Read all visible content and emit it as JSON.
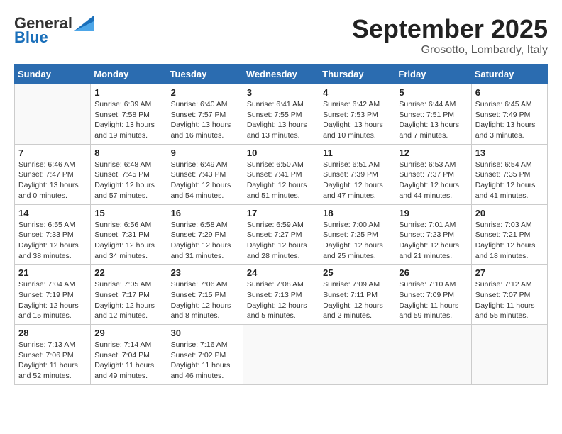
{
  "logo": {
    "general": "General",
    "blue": "Blue"
  },
  "title": "September 2025",
  "subtitle": "Grosotto, Lombardy, Italy",
  "days_of_week": [
    "Sunday",
    "Monday",
    "Tuesday",
    "Wednesday",
    "Thursday",
    "Friday",
    "Saturday"
  ],
  "weeks": [
    [
      {
        "day": "",
        "info": ""
      },
      {
        "day": "1",
        "info": "Sunrise: 6:39 AM\nSunset: 7:58 PM\nDaylight: 13 hours\nand 19 minutes."
      },
      {
        "day": "2",
        "info": "Sunrise: 6:40 AM\nSunset: 7:57 PM\nDaylight: 13 hours\nand 16 minutes."
      },
      {
        "day": "3",
        "info": "Sunrise: 6:41 AM\nSunset: 7:55 PM\nDaylight: 13 hours\nand 13 minutes."
      },
      {
        "day": "4",
        "info": "Sunrise: 6:42 AM\nSunset: 7:53 PM\nDaylight: 13 hours\nand 10 minutes."
      },
      {
        "day": "5",
        "info": "Sunrise: 6:44 AM\nSunset: 7:51 PM\nDaylight: 13 hours\nand 7 minutes."
      },
      {
        "day": "6",
        "info": "Sunrise: 6:45 AM\nSunset: 7:49 PM\nDaylight: 13 hours\nand 3 minutes."
      }
    ],
    [
      {
        "day": "7",
        "info": "Sunrise: 6:46 AM\nSunset: 7:47 PM\nDaylight: 13 hours\nand 0 minutes."
      },
      {
        "day": "8",
        "info": "Sunrise: 6:48 AM\nSunset: 7:45 PM\nDaylight: 12 hours\nand 57 minutes."
      },
      {
        "day": "9",
        "info": "Sunrise: 6:49 AM\nSunset: 7:43 PM\nDaylight: 12 hours\nand 54 minutes."
      },
      {
        "day": "10",
        "info": "Sunrise: 6:50 AM\nSunset: 7:41 PM\nDaylight: 12 hours\nand 51 minutes."
      },
      {
        "day": "11",
        "info": "Sunrise: 6:51 AM\nSunset: 7:39 PM\nDaylight: 12 hours\nand 47 minutes."
      },
      {
        "day": "12",
        "info": "Sunrise: 6:53 AM\nSunset: 7:37 PM\nDaylight: 12 hours\nand 44 minutes."
      },
      {
        "day": "13",
        "info": "Sunrise: 6:54 AM\nSunset: 7:35 PM\nDaylight: 12 hours\nand 41 minutes."
      }
    ],
    [
      {
        "day": "14",
        "info": "Sunrise: 6:55 AM\nSunset: 7:33 PM\nDaylight: 12 hours\nand 38 minutes."
      },
      {
        "day": "15",
        "info": "Sunrise: 6:56 AM\nSunset: 7:31 PM\nDaylight: 12 hours\nand 34 minutes."
      },
      {
        "day": "16",
        "info": "Sunrise: 6:58 AM\nSunset: 7:29 PM\nDaylight: 12 hours\nand 31 minutes."
      },
      {
        "day": "17",
        "info": "Sunrise: 6:59 AM\nSunset: 7:27 PM\nDaylight: 12 hours\nand 28 minutes."
      },
      {
        "day": "18",
        "info": "Sunrise: 7:00 AM\nSunset: 7:25 PM\nDaylight: 12 hours\nand 25 minutes."
      },
      {
        "day": "19",
        "info": "Sunrise: 7:01 AM\nSunset: 7:23 PM\nDaylight: 12 hours\nand 21 minutes."
      },
      {
        "day": "20",
        "info": "Sunrise: 7:03 AM\nSunset: 7:21 PM\nDaylight: 12 hours\nand 18 minutes."
      }
    ],
    [
      {
        "day": "21",
        "info": "Sunrise: 7:04 AM\nSunset: 7:19 PM\nDaylight: 12 hours\nand 15 minutes."
      },
      {
        "day": "22",
        "info": "Sunrise: 7:05 AM\nSunset: 7:17 PM\nDaylight: 12 hours\nand 12 minutes."
      },
      {
        "day": "23",
        "info": "Sunrise: 7:06 AM\nSunset: 7:15 PM\nDaylight: 12 hours\nand 8 minutes."
      },
      {
        "day": "24",
        "info": "Sunrise: 7:08 AM\nSunset: 7:13 PM\nDaylight: 12 hours\nand 5 minutes."
      },
      {
        "day": "25",
        "info": "Sunrise: 7:09 AM\nSunset: 7:11 PM\nDaylight: 12 hours\nand 2 minutes."
      },
      {
        "day": "26",
        "info": "Sunrise: 7:10 AM\nSunset: 7:09 PM\nDaylight: 11 hours\nand 59 minutes."
      },
      {
        "day": "27",
        "info": "Sunrise: 7:12 AM\nSunset: 7:07 PM\nDaylight: 11 hours\nand 55 minutes."
      }
    ],
    [
      {
        "day": "28",
        "info": "Sunrise: 7:13 AM\nSunset: 7:06 PM\nDaylight: 11 hours\nand 52 minutes."
      },
      {
        "day": "29",
        "info": "Sunrise: 7:14 AM\nSunset: 7:04 PM\nDaylight: 11 hours\nand 49 minutes."
      },
      {
        "day": "30",
        "info": "Sunrise: 7:16 AM\nSunset: 7:02 PM\nDaylight: 11 hours\nand 46 minutes."
      },
      {
        "day": "",
        "info": ""
      },
      {
        "day": "",
        "info": ""
      },
      {
        "day": "",
        "info": ""
      },
      {
        "day": "",
        "info": ""
      }
    ]
  ]
}
